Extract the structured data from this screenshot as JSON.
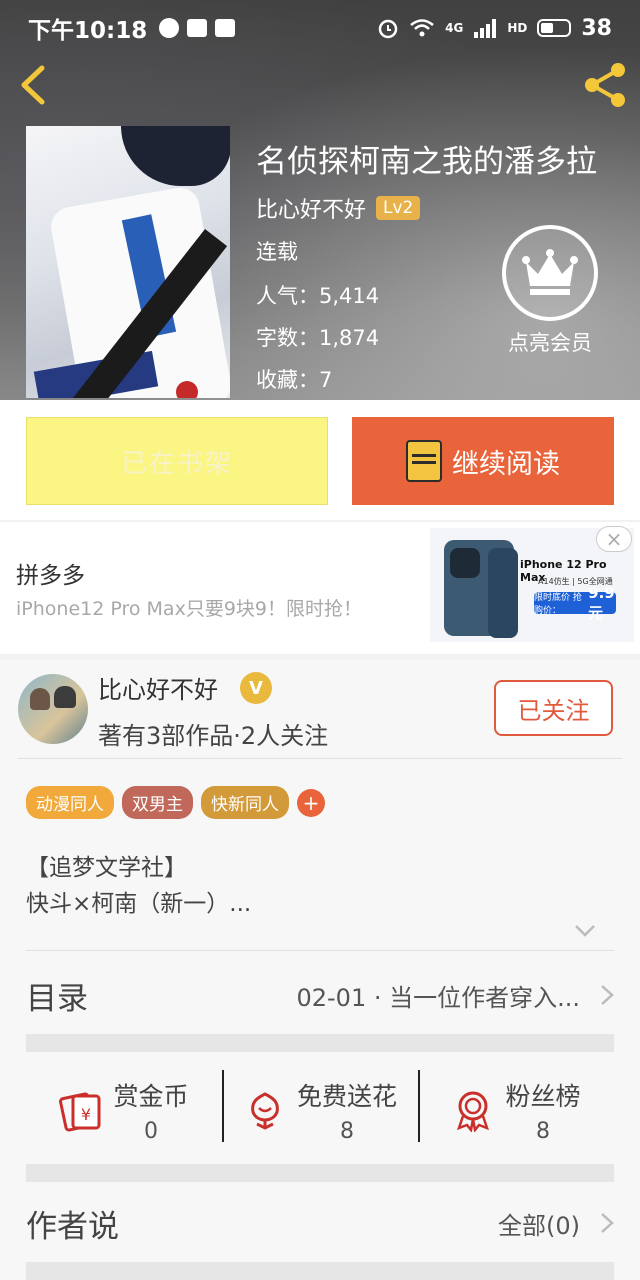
{
  "status_bar": {
    "time": "下午10:18",
    "net_label": "4G",
    "hd_label": "HD",
    "battery": "38"
  },
  "book": {
    "title": "名侦探柯南之我的潘多拉",
    "author": "比心好不好",
    "level": "Lv2",
    "status": "连载",
    "popularity": "人气：5,414",
    "words": "字数：1,874",
    "favorites": "收藏：7"
  },
  "vip": {
    "label": "点亮会员"
  },
  "actions": {
    "shelf_label": "已在书架",
    "read_label": "继续阅读"
  },
  "ad": {
    "title": "拼多多",
    "desc": "iPhone12 Pro Max只要9块9！限时抢！",
    "image_model": "iPhone 12 Pro Max",
    "image_sub": "A14仿生 | 5G全网通",
    "image_price_label": "限时底价 抢购价：",
    "image_price": "9.9元"
  },
  "author_card": {
    "name": "比心好不好",
    "badge": "V",
    "stats": "著有3部作品·2人关注",
    "follow_label": "已关注"
  },
  "tags": [
    {
      "label": "动漫同人",
      "color": "#f2a93b"
    },
    {
      "label": "双男主",
      "color": "#c0695a"
    },
    {
      "label": "快新同人",
      "color": "#d39a3a"
    }
  ],
  "tag_add": "+",
  "intro": {
    "line1": "【追梦文学社】",
    "line2": "快斗×柯南（新一）..."
  },
  "toc": {
    "label": "目录",
    "latest": "02-01 · 当一位作者穿入..."
  },
  "stats": [
    {
      "label": "赏金币",
      "value": "0",
      "icon": "red-envelope-icon"
    },
    {
      "label": "免费送花",
      "value": "8",
      "icon": "flower-icon"
    },
    {
      "label": "粉丝榜",
      "value": "8",
      "icon": "medal-icon"
    }
  ],
  "author_say": {
    "label": "作者说",
    "all": "全部(0)"
  },
  "colors": {
    "accent": "#e9643b",
    "shelf": "#fbf684",
    "gold": "#e7b24a"
  }
}
